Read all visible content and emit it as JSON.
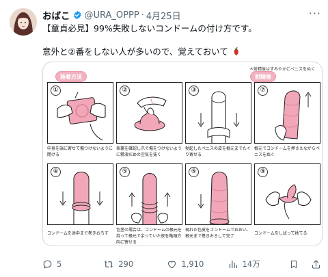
{
  "tweet": {
    "display_name": "おばこ",
    "handle": "@URA_OPPP",
    "separator": "·",
    "date": "4月25日",
    "more_label": "···",
    "line1": "【童貞必見】99%失敗しないコンドームの付け方です。",
    "line2": "意外と②番をしない人が多いので、覚えておいて",
    "accent": "#1d9bf0"
  },
  "image": {
    "note": "＊射精後はすみやかにペニスをぬく",
    "banner_left": "装着方法",
    "banner_right": "射精後",
    "steps": [
      {
        "num": "①",
        "caption": "中身を端に寄せて傷つけないように開ける"
      },
      {
        "num": "②",
        "caption": "表裏を確認し爪で傷をつけないように精液だめの空気を抜く"
      },
      {
        "num": "③",
        "caption": "勃起したペニスの皮を根元までたぐり寄せる"
      },
      {
        "num": "⑦",
        "caption": "根元でコンドームを押さえながらペニスをぬく"
      },
      {
        "num": "④",
        "caption": "コンドームを途中まで巻きおろす"
      },
      {
        "num": "⑤",
        "caption": "包茎の場合は、コンドームの根元を持って根元で余っていた皮を亀頭方向に寄せる"
      },
      {
        "num": "⑥",
        "caption": "現れた包皮をコンドームでおおい、根元まで巻きおろして完了"
      },
      {
        "num": "⑧",
        "caption": "コンドームをしばって捨てる"
      }
    ],
    "palette": {
      "pink": "#f2a7b9",
      "pink_dark": "#d97f96",
      "skin": "#ffffff",
      "line": "#222222"
    }
  },
  "actions": {
    "replies": "5",
    "reposts": "290",
    "likes": "1,910",
    "views": "14万"
  }
}
